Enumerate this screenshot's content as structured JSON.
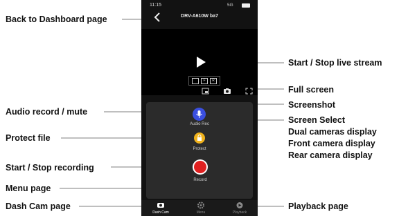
{
  "annotations": {
    "back": "Back to Dashboard page",
    "live": "Start / Stop live stream",
    "fullscreen": "Full screen",
    "screenshot": "Screenshot",
    "audio": "Audio record / mute",
    "screen_select": "Screen Select",
    "dual": "Dual cameras display",
    "front": "Front camera display",
    "rear": "Rear camera display",
    "protect": "Protect file",
    "recording": "Start / Stop recording",
    "menu": "Menu page",
    "dashcam": "Dash Cam page",
    "playback": "Playback page"
  },
  "status_bar": {
    "time": "11:15",
    "network": "5G"
  },
  "header": {
    "title": "DRV-A610W ba7"
  },
  "controls": {
    "audio_label": "Audio Rec",
    "protect_label": "Protect",
    "record_label": "Record"
  },
  "mode_buttons": [
    "",
    "F",
    "R"
  ],
  "nav": {
    "dashcam": "Dash Cam",
    "menu": "Menu",
    "playback": "Playback"
  },
  "colors": {
    "audio": "#3a4fe0",
    "protect": "#f0b21c",
    "record": "#e02020",
    "active_nav": "#ffffff",
    "inactive_nav": "#8a8a8a"
  }
}
